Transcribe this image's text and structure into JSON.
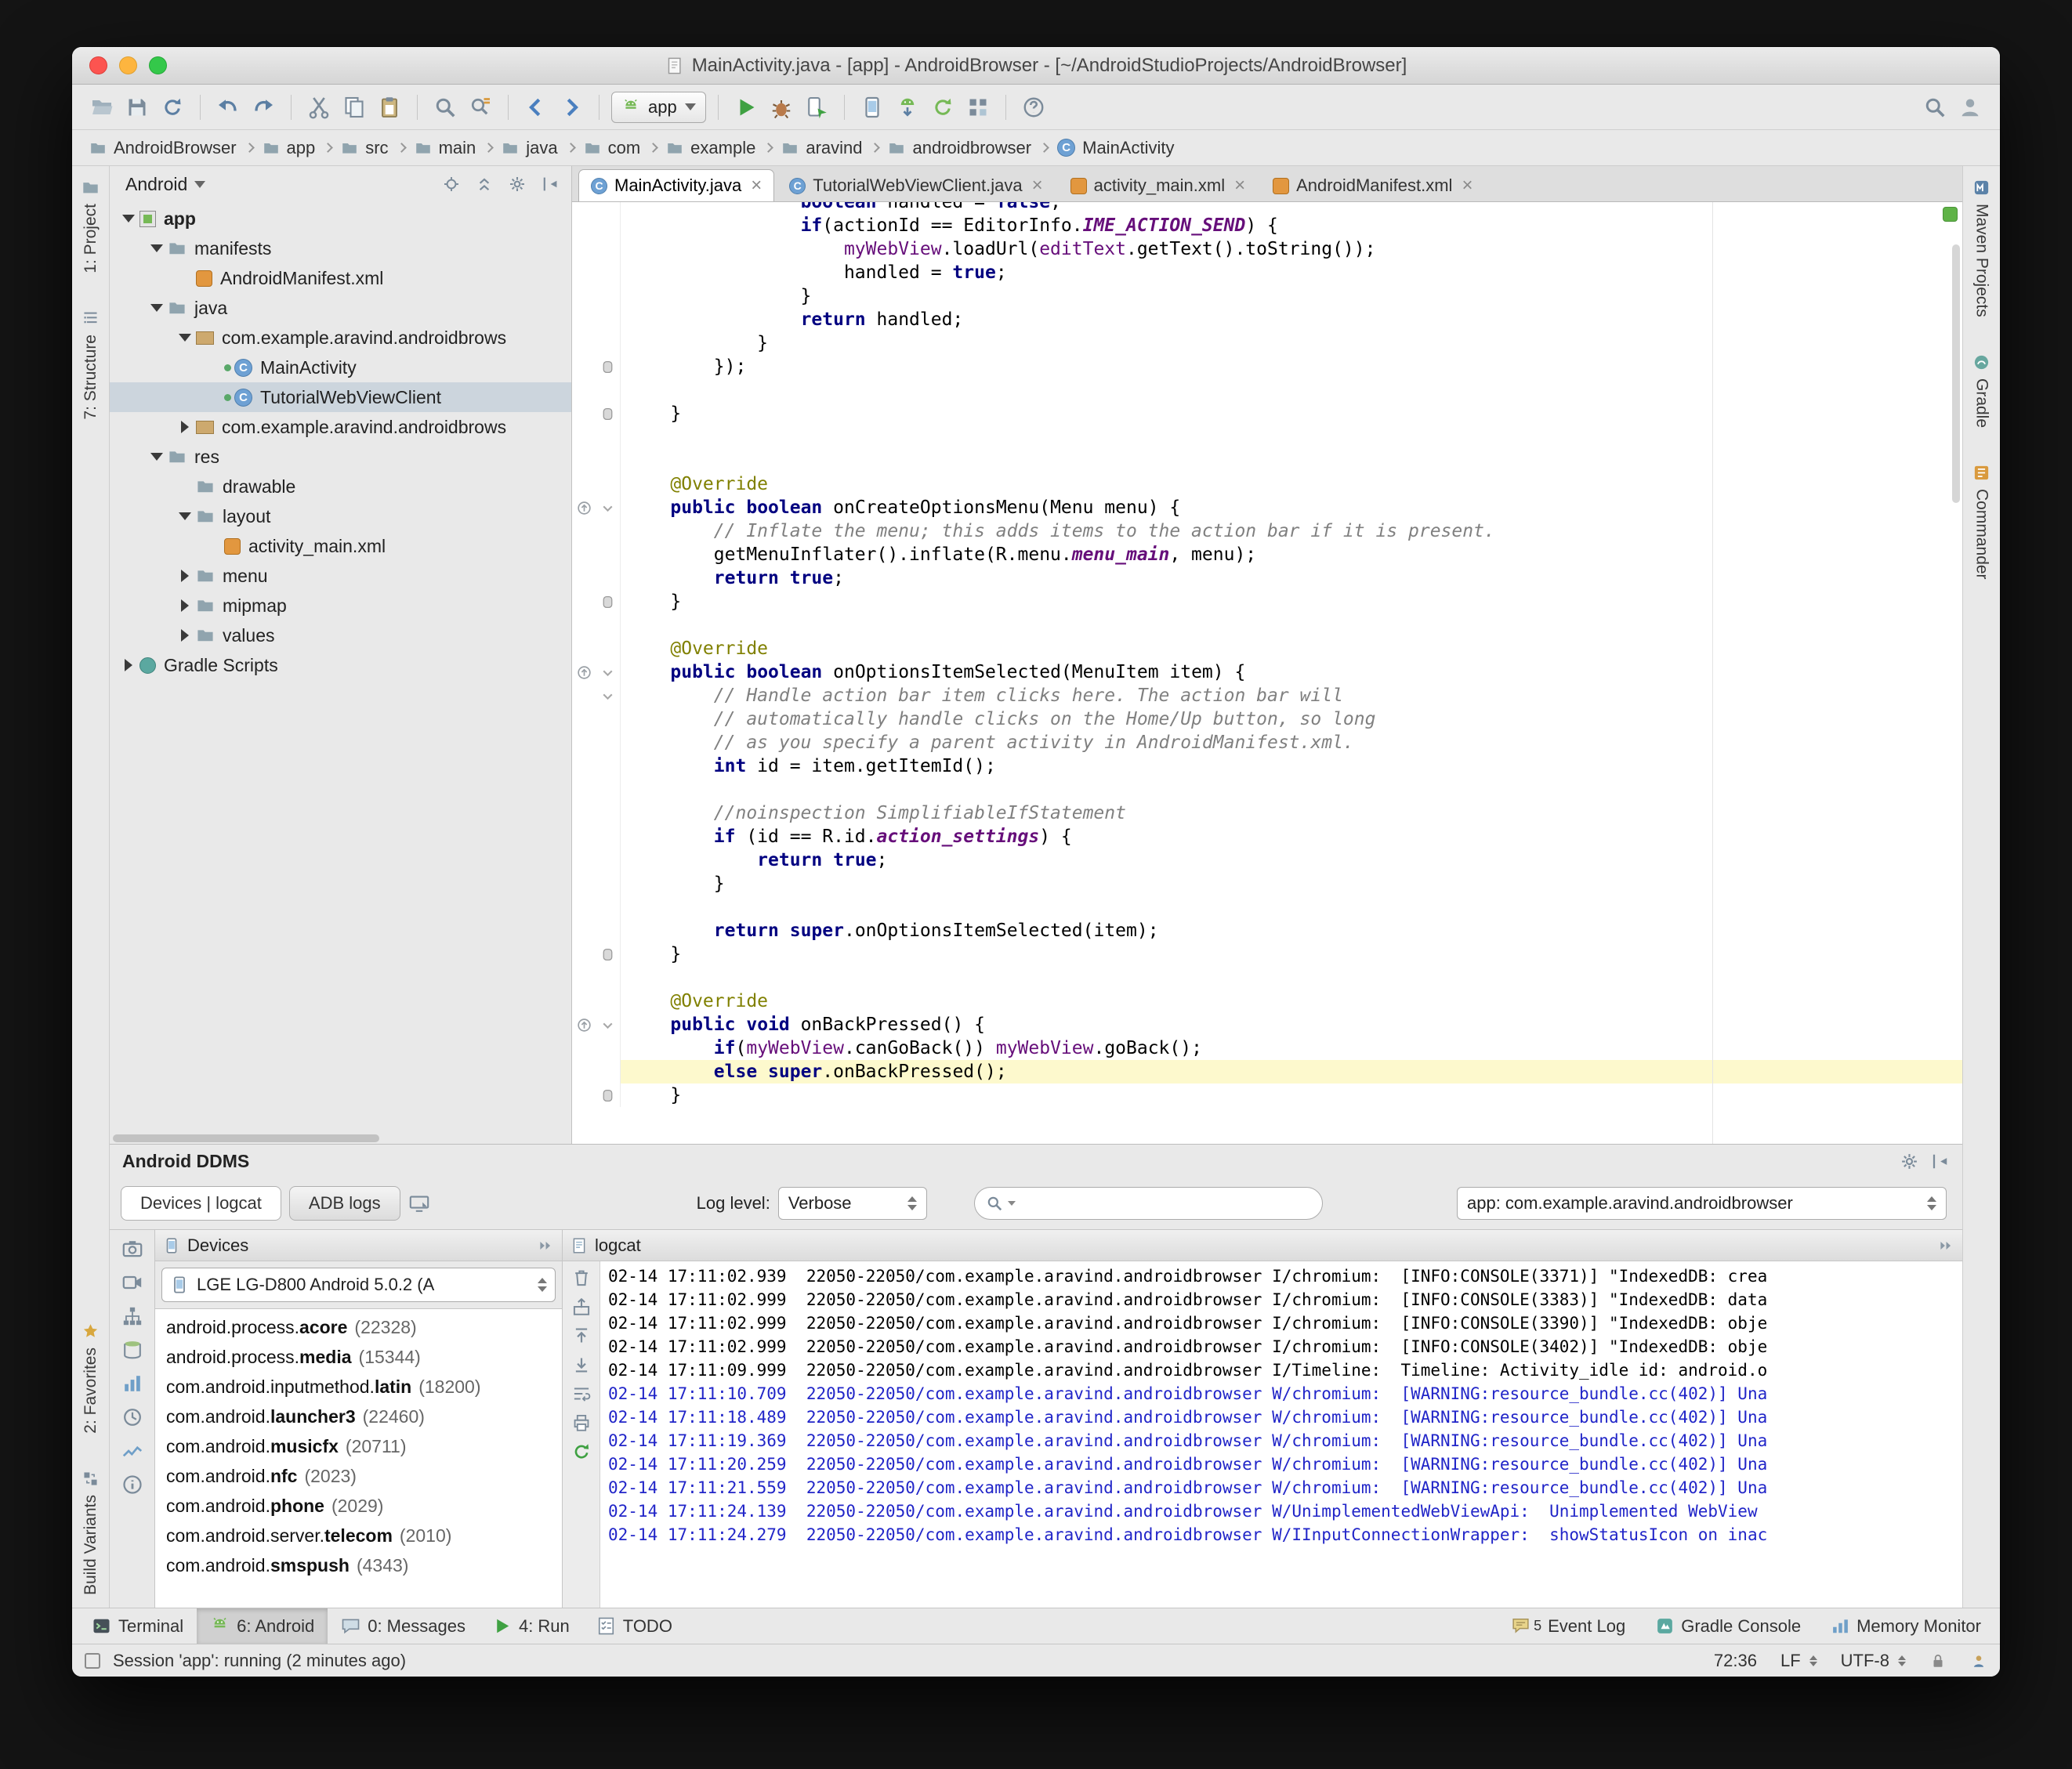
{
  "window": {
    "title": "MainActivity.java - [app] - AndroidBrowser - [~/AndroidStudioProjects/AndroidBrowser]"
  },
  "toolbar": {
    "left_groups": [
      [
        "open-icon",
        "save-icon",
        "sync-icon"
      ],
      [
        "undo-icon",
        "redo-icon"
      ],
      [
        "cut-icon",
        "copy-icon",
        "paste-icon"
      ],
      [
        "find-icon",
        "replace-icon"
      ],
      [
        "back-icon",
        "forward-icon"
      ]
    ],
    "run_config_label": "app",
    "run_groups": [
      [
        "run-icon",
        "debug-icon",
        "attach-debugger-icon"
      ],
      [
        "avd-manager-icon",
        "sdk-manager-icon",
        "sync-project-icon",
        "project-structure-icon"
      ],
      [
        "help-icon"
      ]
    ],
    "right_icons": [
      "search-everywhere-icon",
      "user-icon"
    ]
  },
  "breadcrumbs": [
    {
      "label": "AndroidBrowser",
      "icon": "folder-icon"
    },
    {
      "label": "app",
      "icon": "folder-icon"
    },
    {
      "label": "src",
      "icon": "folder-icon"
    },
    {
      "label": "main",
      "icon": "folder-icon"
    },
    {
      "label": "java",
      "icon": "folder-icon"
    },
    {
      "label": "com",
      "icon": "folder-icon"
    },
    {
      "label": "example",
      "icon": "folder-icon"
    },
    {
      "label": "aravind",
      "icon": "folder-icon"
    },
    {
      "label": "androidbrowser",
      "icon": "folder-icon"
    },
    {
      "label": "MainActivity",
      "icon": "class-file-icon"
    }
  ],
  "left_strip": {
    "top": [
      {
        "label": "1: Project",
        "icon": "project-tool-icon"
      },
      {
        "label": "7: Structure",
        "icon": "structure-tool-icon"
      }
    ],
    "bottom": [
      {
        "label": "2: Favorites",
        "icon": "favorites-tool-icon"
      },
      {
        "label": "Build Variants",
        "icon": "build-variants-tool-icon"
      }
    ]
  },
  "right_strip": [
    {
      "label": "Maven Projects",
      "icon": "maven-tool-icon"
    },
    {
      "label": "Gradle",
      "icon": "gradle-tool-icon"
    },
    {
      "label": "Commander",
      "icon": "commander-tool-icon"
    }
  ],
  "project": {
    "mode_label": "Android",
    "header_icons": [
      "target-icon",
      "collapse-all-icon",
      "settings-icon",
      "hide-panel-icon"
    ],
    "tree": [
      {
        "depth": 0,
        "arrow": "down",
        "icon": "module-icon",
        "label": "app",
        "bold": true
      },
      {
        "depth": 1,
        "arrow": "down",
        "icon": "folder-icon",
        "label": "manifests"
      },
      {
        "depth": 2,
        "arrow": "",
        "icon": "android-xml-icon",
        "label": "AndroidManifest.xml"
      },
      {
        "depth": 1,
        "arrow": "down",
        "icon": "folder-icon",
        "label": "java"
      },
      {
        "depth": 2,
        "arrow": "down",
        "icon": "package-icon",
        "label": "com.example.aravind.androidbrows"
      },
      {
        "depth": 3,
        "arrow": "",
        "icon": "class-icon",
        "label": "MainActivity"
      },
      {
        "depth": 3,
        "arrow": "",
        "icon": "class-icon",
        "label": "TutorialWebViewClient",
        "selected": true
      },
      {
        "depth": 2,
        "arrow": "right",
        "icon": "package-icon",
        "label": "com.example.aravind.androidbrows"
      },
      {
        "depth": 1,
        "arrow": "down",
        "icon": "folder-icon",
        "label": "res"
      },
      {
        "depth": 2,
        "arrow": "",
        "icon": "folder-icon",
        "label": "drawable"
      },
      {
        "depth": 2,
        "arrow": "down",
        "icon": "folder-icon",
        "label": "layout"
      },
      {
        "depth": 3,
        "arrow": "",
        "icon": "android-xml-icon",
        "label": "activity_main.xml"
      },
      {
        "depth": 2,
        "arrow": "right",
        "icon": "folder-icon",
        "label": "menu"
      },
      {
        "depth": 2,
        "arrow": "right",
        "icon": "folder-icon",
        "label": "mipmap"
      },
      {
        "depth": 2,
        "arrow": "right",
        "icon": "folder-icon",
        "label": "values"
      },
      {
        "depth": 0,
        "arrow": "right",
        "icon": "gradle-node-icon",
        "label": "Gradle Scripts"
      }
    ]
  },
  "editor": {
    "tabs": [
      {
        "label": "MainActivity.java",
        "icon": "class-file-icon",
        "active": true
      },
      {
        "label": "TutorialWebViewClient.java",
        "icon": "class-file-icon",
        "active": false
      },
      {
        "label": "activity_main.xml",
        "icon": "android-xml-icon",
        "active": false
      },
      {
        "label": "AndroidManifest.xml",
        "icon": "android-xml-icon",
        "active": false
      }
    ],
    "lines": [
      {
        "s": [
          [
            "p",
            "                "
          ],
          [
            "k",
            "boolean"
          ],
          [
            "p",
            " handled = "
          ],
          [
            "k",
            "false"
          ],
          [
            "p",
            ";"
          ]
        ]
      },
      {
        "s": [
          [
            "p",
            "                "
          ],
          [
            "k",
            "if"
          ],
          [
            "p",
            "(actionId == EditorInfo."
          ],
          [
            "sf",
            "IME_ACTION_SEND"
          ],
          [
            "p",
            ") {"
          ]
        ]
      },
      {
        "s": [
          [
            "p",
            "                    "
          ],
          [
            "fd",
            "myWebView"
          ],
          [
            "p",
            ".loadUrl("
          ],
          [
            "fd",
            "editText"
          ],
          [
            "p",
            ".getText().toString());"
          ]
        ]
      },
      {
        "s": [
          [
            "p",
            "                    handled = "
          ],
          [
            "k",
            "true"
          ],
          [
            "p",
            ";"
          ]
        ]
      },
      {
        "s": [
          [
            "p",
            "                }"
          ]
        ]
      },
      {
        "s": [
          [
            "p",
            "                "
          ],
          [
            "k",
            "return"
          ],
          [
            "p",
            " handled;"
          ]
        ]
      },
      {
        "s": [
          [
            "p",
            "            }"
          ]
        ]
      },
      {
        "s": [
          [
            "p",
            "        });"
          ]
        ],
        "g": "f"
      },
      {
        "s": []
      },
      {
        "s": [
          [
            "p",
            "    }"
          ]
        ],
        "g": "f"
      },
      {
        "s": []
      },
      {
        "s": []
      },
      {
        "s": [
          [
            "a",
            "    @Override"
          ]
        ]
      },
      {
        "s": [
          [
            "p",
            "    "
          ],
          [
            "k",
            "public"
          ],
          [
            "p",
            " "
          ],
          [
            "k",
            "boolean"
          ],
          [
            "p",
            " onCreateOptionsMenu(Menu menu) {"
          ]
        ],
        "g": "o"
      },
      {
        "s": [
          [
            "p",
            "        "
          ],
          [
            "c",
            "// Inflate the menu; this adds items to the action bar if it is present."
          ]
        ]
      },
      {
        "s": [
          [
            "p",
            "        getMenuInflater().inflate(R.menu."
          ],
          [
            "sf",
            "menu_main"
          ],
          [
            "p",
            ", menu);"
          ]
        ]
      },
      {
        "s": [
          [
            "p",
            "        "
          ],
          [
            "k",
            "return"
          ],
          [
            "p",
            " "
          ],
          [
            "k",
            "true"
          ],
          [
            "p",
            ";"
          ]
        ]
      },
      {
        "s": [
          [
            "p",
            "    }"
          ]
        ],
        "g": "f"
      },
      {
        "s": []
      },
      {
        "s": [
          [
            "a",
            "    @Override"
          ]
        ]
      },
      {
        "s": [
          [
            "p",
            "    "
          ],
          [
            "k",
            "public"
          ],
          [
            "p",
            " "
          ],
          [
            "k",
            "boolean"
          ],
          [
            "p",
            " onOptionsItemSelected(MenuItem item) {"
          ]
        ],
        "g": "o"
      },
      {
        "s": [
          [
            "p",
            "        "
          ],
          [
            "c",
            "// Handle action bar item clicks here. The action bar will"
          ]
        ],
        "g": "fa"
      },
      {
        "s": [
          [
            "p",
            "        "
          ],
          [
            "c",
            "// automatically handle clicks on the Home/Up button, so long"
          ]
        ]
      },
      {
        "s": [
          [
            "p",
            "        "
          ],
          [
            "c",
            "// as you specify a parent activity in AndroidManifest.xml."
          ]
        ]
      },
      {
        "s": [
          [
            "p",
            "        "
          ],
          [
            "k",
            "int"
          ],
          [
            "p",
            " id = item.getItemId();"
          ]
        ]
      },
      {
        "s": []
      },
      {
        "s": [
          [
            "p",
            "        "
          ],
          [
            "c",
            "//noinspection SimplifiableIfStatement"
          ]
        ]
      },
      {
        "s": [
          [
            "p",
            "        "
          ],
          [
            "k",
            "if"
          ],
          [
            "p",
            " (id == R.id."
          ],
          [
            "sf",
            "action_settings"
          ],
          [
            "p",
            ") {"
          ]
        ]
      },
      {
        "s": [
          [
            "p",
            "            "
          ],
          [
            "k",
            "return"
          ],
          [
            "p",
            " "
          ],
          [
            "k",
            "true"
          ],
          [
            "p",
            ";"
          ]
        ]
      },
      {
        "s": [
          [
            "p",
            "        }"
          ]
        ]
      },
      {
        "s": []
      },
      {
        "s": [
          [
            "p",
            "        "
          ],
          [
            "k",
            "return"
          ],
          [
            "p",
            " "
          ],
          [
            "k",
            "super"
          ],
          [
            "p",
            ".onOptionsItemSelected(item);"
          ]
        ]
      },
      {
        "s": [
          [
            "p",
            "    }"
          ]
        ],
        "g": "f"
      },
      {
        "s": []
      },
      {
        "s": [
          [
            "a",
            "    @Override"
          ]
        ]
      },
      {
        "s": [
          [
            "p",
            "    "
          ],
          [
            "k",
            "public"
          ],
          [
            "p",
            " "
          ],
          [
            "k",
            "void"
          ],
          [
            "p",
            " onBackPressed() {"
          ]
        ],
        "g": "o"
      },
      {
        "s": [
          [
            "p",
            "        "
          ],
          [
            "k",
            "if"
          ],
          [
            "p",
            "("
          ],
          [
            "fd",
            "myWebView"
          ],
          [
            "p",
            ".canGoBack()) "
          ],
          [
            "fd",
            "myWebView"
          ],
          [
            "p",
            ".goBack();"
          ]
        ]
      },
      {
        "s": [
          [
            "p",
            "        "
          ],
          [
            "k",
            "else"
          ],
          [
            "p",
            " "
          ],
          [
            "k",
            "super"
          ],
          [
            "p",
            ".onBackPressed();"
          ]
        ],
        "hl": true
      },
      {
        "s": [
          [
            "p",
            "    }"
          ]
        ],
        "g": "f"
      }
    ]
  },
  "ddms": {
    "panel_title": "Android DDMS",
    "header_icons": [
      "settings-icon",
      "hide-panel-icon"
    ],
    "tab_devices_logcat": "Devices | logcat",
    "tab_adb_logs": "ADB logs",
    "capture_icon": "screen-capture-icon",
    "log_level_label": "Log level:",
    "log_level_value": "Verbose",
    "search_value": "",
    "filter_value": "app: com.example.aravind.androidbrowser",
    "strip_icons": [
      "screenshot-icon",
      "screen-record-icon",
      "hierarchy-view-icon",
      "heap-dump-icon",
      "allocation-tracker-icon",
      "method-profiling-icon",
      "network-stats-icon",
      "system-info-icon"
    ],
    "devices": {
      "header": "Devices",
      "header_icons": [
        "collapse-panel-icon"
      ],
      "device_name": "LGE LG-D800 Android 5.0.2 (A",
      "processes": [
        {
          "prefix": "android.process.",
          "name": "acore",
          "pid": "(22328)"
        },
        {
          "prefix": "android.process.",
          "name": "media",
          "pid": "(15344)"
        },
        {
          "prefix": "com.android.inputmethod.",
          "name": "latin",
          "pid": "(18200)"
        },
        {
          "prefix": "com.android.",
          "name": "launcher3",
          "pid": "(22460)"
        },
        {
          "prefix": "com.android.",
          "name": "musicfx",
          "pid": "(20711)"
        },
        {
          "prefix": "com.android.",
          "name": "nfc",
          "pid": "(2023)"
        },
        {
          "prefix": "com.android.",
          "name": "phone",
          "pid": "(2029)"
        },
        {
          "prefix": "com.android.server.",
          "name": "telecom",
          "pid": "(2010)"
        },
        {
          "prefix": "com.android.",
          "name": "smspush",
          "pid": "(4343)"
        }
      ]
    },
    "logcat": {
      "header": "logcat",
      "header_icons": [
        "collapse-panel-icon"
      ],
      "tool_icons": [
        "clear-log-icon",
        "export-log-icon",
        "scroll-up-icon",
        "scroll-down-icon",
        "soft-wrap-icon",
        "print-log-icon",
        "restart-logcat-icon"
      ],
      "lines": [
        {
          "t": "02-14 17:11:02.939  22050-22050/com.example.aravind.androidbrowser I/chromium:  [INFO:CONSOLE(3371)] \"IndexedDB: crea",
          "lvl": "i"
        },
        {
          "t": "02-14 17:11:02.999  22050-22050/com.example.aravind.androidbrowser I/chromium:  [INFO:CONSOLE(3383)] \"IndexedDB: data",
          "lvl": "i"
        },
        {
          "t": "02-14 17:11:02.999  22050-22050/com.example.aravind.androidbrowser I/chromium:  [INFO:CONSOLE(3390)] \"IndexedDB: obje",
          "lvl": "i"
        },
        {
          "t": "02-14 17:11:02.999  22050-22050/com.example.aravind.androidbrowser I/chromium:  [INFO:CONSOLE(3402)] \"IndexedDB: obje",
          "lvl": "i"
        },
        {
          "t": "02-14 17:11:09.999  22050-22050/com.example.aravind.androidbrowser I/Timeline:  Timeline: Activity_idle id: android.o",
          "lvl": "i"
        },
        {
          "t": "02-14 17:11:10.709  22050-22050/com.example.aravind.androidbrowser W/chromium:  [WARNING:resource_bundle.cc(402)] Una",
          "lvl": "w"
        },
        {
          "t": "02-14 17:11:18.489  22050-22050/com.example.aravind.androidbrowser W/chromium:  [WARNING:resource_bundle.cc(402)] Una",
          "lvl": "w"
        },
        {
          "t": "02-14 17:11:19.369  22050-22050/com.example.aravind.androidbrowser W/chromium:  [WARNING:resource_bundle.cc(402)] Una",
          "lvl": "w"
        },
        {
          "t": "02-14 17:11:20.259  22050-22050/com.example.aravind.androidbrowser W/chromium:  [WARNING:resource_bundle.cc(402)] Una",
          "lvl": "w"
        },
        {
          "t": "02-14 17:11:21.559  22050-22050/com.example.aravind.androidbrowser W/chromium:  [WARNING:resource_bundle.cc(402)] Una",
          "lvl": "w"
        },
        {
          "t": "02-14 17:11:24.139  22050-22050/com.example.aravind.androidbrowser W/UnimplementedWebViewApi:  Unimplemented WebView",
          "lvl": "w"
        },
        {
          "t": "02-14 17:11:24.279  22050-22050/com.example.aravind.androidbrowser W/IInputConnectionWrapper:  showStatusIcon on inac",
          "lvl": "w"
        }
      ]
    }
  },
  "bottom_bar": {
    "left": [
      {
        "label": "Terminal",
        "icon": "terminal-icon",
        "active": false
      },
      {
        "label": "6: Android",
        "icon": "android-icon",
        "active": true
      },
      {
        "label": "0: Messages",
        "icon": "messages-icon",
        "active": false
      },
      {
        "label": "4: Run",
        "icon": "run-icon",
        "active": false
      },
      {
        "label": "TODO",
        "icon": "todo-icon",
        "active": false
      }
    ],
    "right": [
      {
        "label": "Event Log",
        "icon": "event-log-icon",
        "badge": "5"
      },
      {
        "label": "Gradle Console",
        "icon": "gradle-console-icon",
        "badge": ""
      },
      {
        "label": "Memory Monitor",
        "icon": "memory-monitor-icon",
        "badge": ""
      }
    ]
  },
  "status_bar": {
    "message": "Session 'app': running (2 minutes ago)",
    "position": "72:36",
    "line_ending": "LF",
    "encoding": "UTF-8"
  }
}
